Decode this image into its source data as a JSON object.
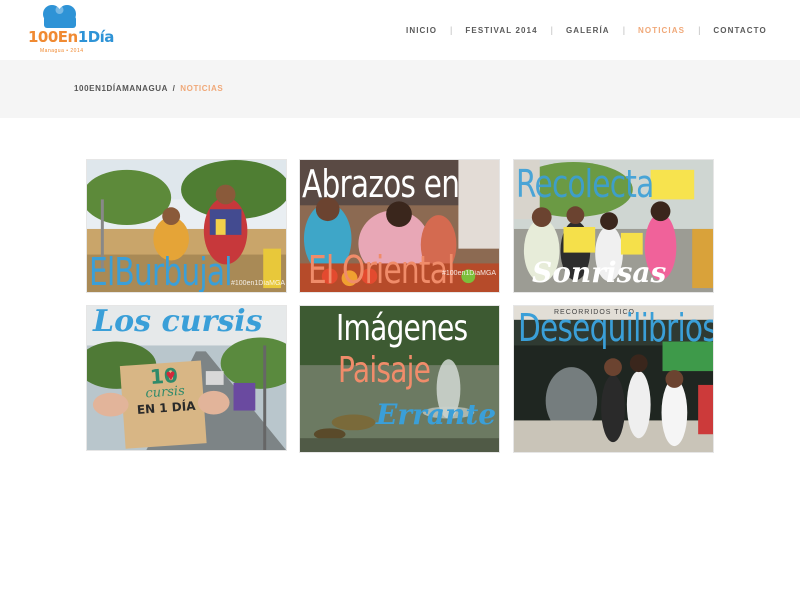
{
  "logo": {
    "text_a": "100En",
    "text_b": "1",
    "text_c": "Día",
    "subtitle": "Managua • 2014"
  },
  "nav": {
    "items": [
      {
        "label": "INICIO",
        "active": false
      },
      {
        "label": "FESTIVAL 2014",
        "active": false
      },
      {
        "label": "GALERÍA",
        "active": false
      },
      {
        "label": "NOTICIAS",
        "active": true
      },
      {
        "label": "CONTACTO",
        "active": false
      }
    ],
    "separator": "|"
  },
  "breadcrumb": {
    "home": "100EN1DÍAMANAGUA",
    "separator": "/",
    "current": "NOTICIAS"
  },
  "tiles": [
    {
      "title": "ElBurbujal",
      "tag": "#100en1DíaMGA"
    },
    {
      "title_a": "Abrazos en",
      "title_b": "El Oriental",
      "tag": "#100en1DíaMGA"
    },
    {
      "title_a": "Recolecta",
      "title_b": "Sonrisas"
    },
    {
      "title": "Los cursis",
      "sign_a": "10",
      "sign_b": "cursis",
      "sign_c": "EN 1 DÍA"
    },
    {
      "title_a": "Imágenes",
      "title_b": "Paisaje",
      "title_c": "Errante"
    },
    {
      "title": "Desequilibrios",
      "sign": "RECORRIDOS TICO"
    }
  ],
  "colors": {
    "accent_orange": "#f0a878",
    "logo_orange": "#f08a32",
    "logo_blue": "#2e93d6",
    "title_blue": "#3a9fd8",
    "title_salmon": "#f08c6a"
  }
}
